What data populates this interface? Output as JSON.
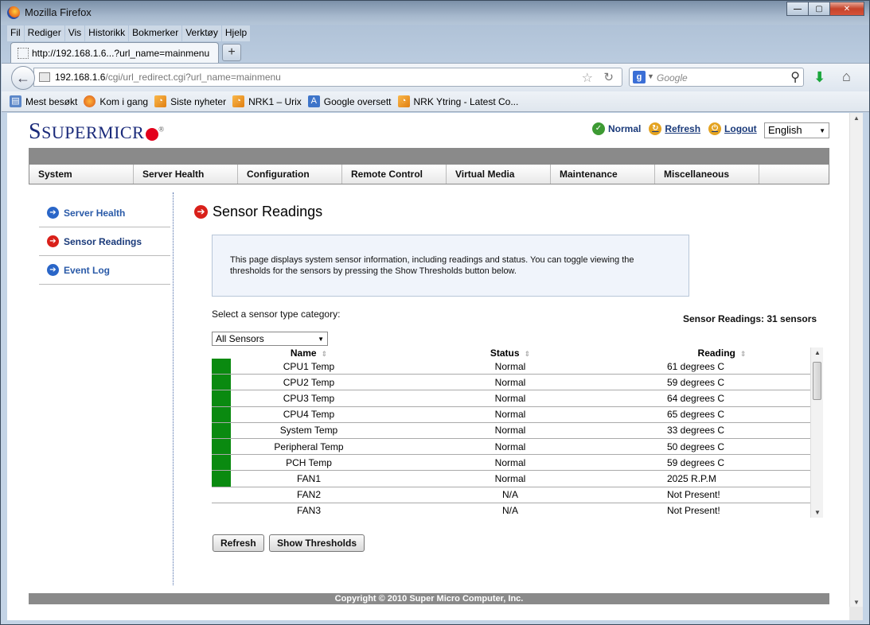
{
  "window": {
    "title": "Mozilla Firefox"
  },
  "menubar": [
    "Fil",
    "Rediger",
    "Vis",
    "Historikk",
    "Bokmerker",
    "Verktøy",
    "Hjelp"
  ],
  "tab": {
    "label": "http://192.168.1.6...?url_name=mainmenu"
  },
  "urlbar": {
    "host": "192.168.1.6",
    "path": "/cgi/url_redirect.cgi?url_name=mainmenu"
  },
  "search": {
    "placeholder": "Google",
    "engine": "g"
  },
  "bookmarks": [
    {
      "label": "Mest besøkt",
      "icon": "bookmark-icon"
    },
    {
      "label": "Kom i gang",
      "icon": "firefox-icon"
    },
    {
      "label": "Siste nyheter",
      "icon": "rss-icon"
    },
    {
      "label": "NRK1 – Urix",
      "icon": "rss-icon"
    },
    {
      "label": "Google oversett",
      "icon": "translate-icon"
    },
    {
      "label": "NRK Ytring - Latest Co...",
      "icon": "rss-icon"
    }
  ],
  "header": {
    "logo": "SUPERMICR",
    "status": "Normal",
    "refresh": "Refresh",
    "logout": "Logout",
    "language": "English"
  },
  "mainnav": [
    "System",
    "Server Health",
    "Configuration",
    "Remote Control",
    "Virtual Media",
    "Maintenance",
    "Miscellaneous"
  ],
  "sidenav": [
    "Server Health",
    "Sensor Readings",
    "Event Log"
  ],
  "page": {
    "title": "Sensor Readings",
    "info": "This page displays system sensor information, including readings and status. You can toggle viewing the thresholds for the sensors by pressing the Show Thresholds button below.",
    "select_label": "Select a sensor type category:",
    "sensor_count": "Sensor Readings: 31 sensors",
    "sensor_category": "All Sensors"
  },
  "table": {
    "headers": {
      "name": "Name",
      "status": "Status",
      "reading": "Reading"
    },
    "rows": [
      {
        "name": "CPU1 Temp",
        "status": "Normal",
        "reading": "61 degrees C",
        "indicator": "#0a8a10"
      },
      {
        "name": "CPU2 Temp",
        "status": "Normal",
        "reading": "59 degrees C",
        "indicator": "#0a8a10"
      },
      {
        "name": "CPU3 Temp",
        "status": "Normal",
        "reading": "64 degrees C",
        "indicator": "#0a8a10"
      },
      {
        "name": "CPU4 Temp",
        "status": "Normal",
        "reading": "65 degrees C",
        "indicator": "#0a8a10"
      },
      {
        "name": "System Temp",
        "status": "Normal",
        "reading": "33 degrees C",
        "indicator": "#0a8a10"
      },
      {
        "name": "Peripheral Temp",
        "status": "Normal",
        "reading": "50 degrees C",
        "indicator": "#0a8a10"
      },
      {
        "name": "PCH Temp",
        "status": "Normal",
        "reading": "59 degrees C",
        "indicator": "#0a8a10"
      },
      {
        "name": "FAN1",
        "status": "Normal",
        "reading": "2025 R.P.M",
        "indicator": "#0a8a10"
      },
      {
        "name": "FAN2",
        "status": "N/A",
        "reading": "Not Present!",
        "indicator": ""
      },
      {
        "name": "FAN3",
        "status": "N/A",
        "reading": "Not Present!",
        "indicator": ""
      }
    ]
  },
  "buttons": {
    "refresh": "Refresh",
    "show_thresholds": "Show Thresholds"
  },
  "footer": "Copyright © 2010 Super Micro Computer, Inc."
}
